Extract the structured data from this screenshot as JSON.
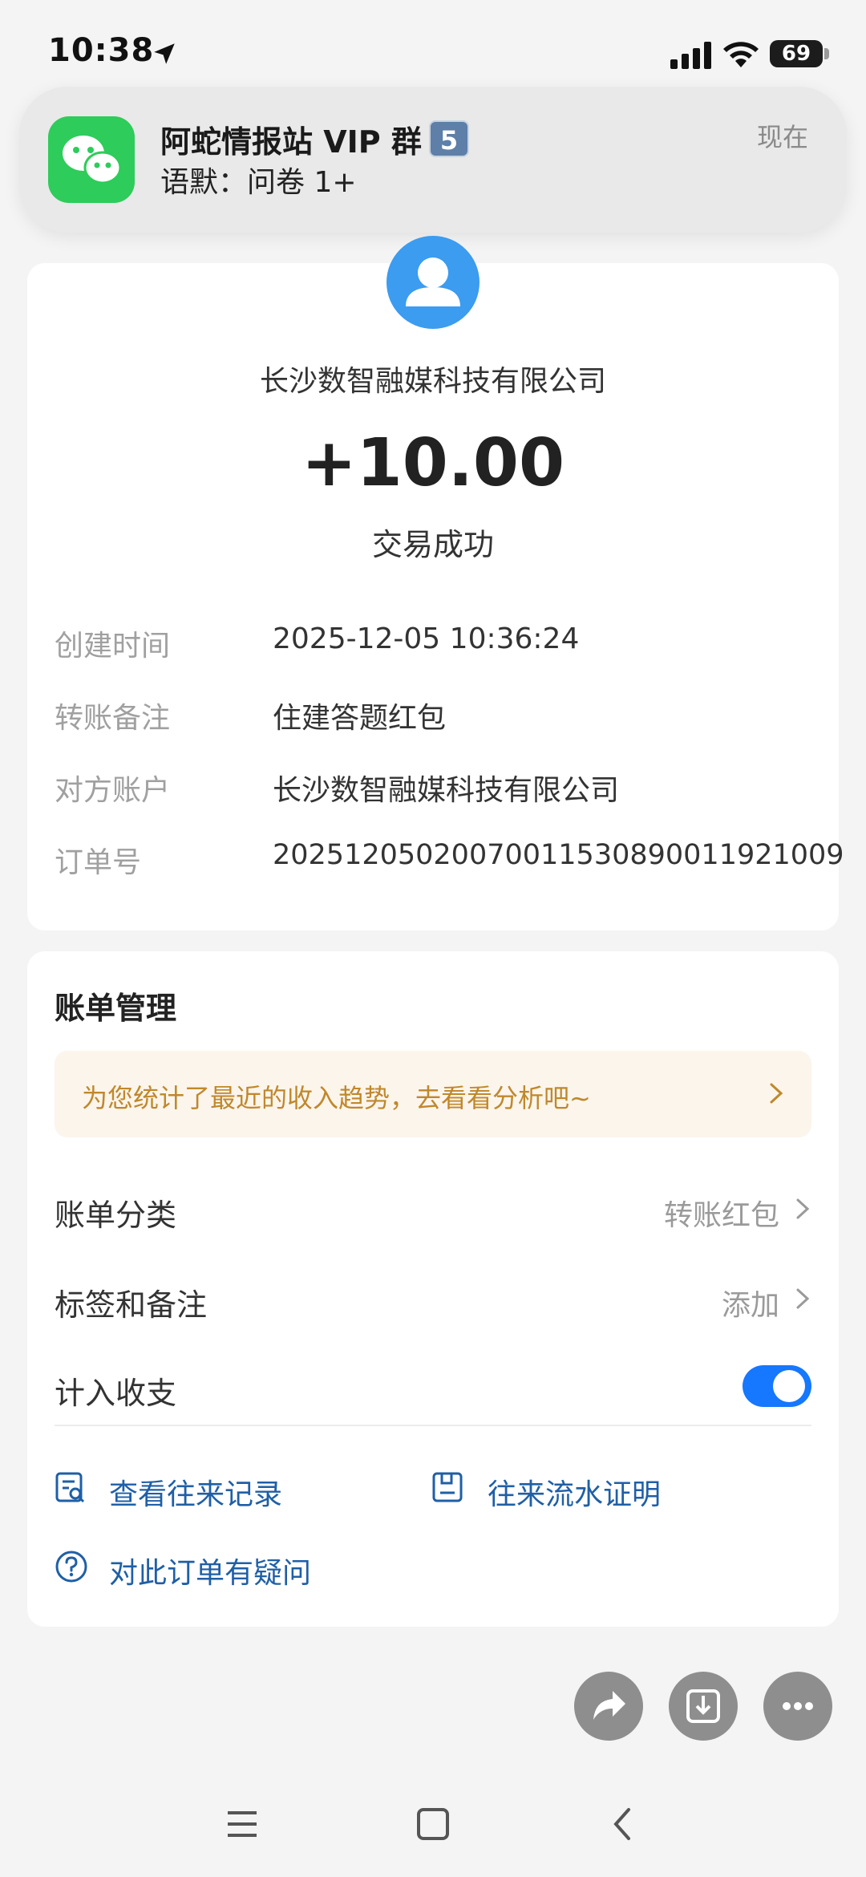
{
  "status_bar": {
    "time": "10:38",
    "battery": "69"
  },
  "notification": {
    "app_icon": "wechat-icon",
    "title": "阿蛇情报站 VIP 群",
    "badge": "5",
    "message": "语默：问卷 1+",
    "time": "现在"
  },
  "transaction": {
    "payer": "长沙数智融媒科技有限公司",
    "amount": "+10.00",
    "status": "交易成功",
    "details": [
      {
        "label": "创建时间",
        "value": "2025-12-05 10:36:24"
      },
      {
        "label": "转账备注",
        "value": "住建答题红包"
      },
      {
        "label": "对方账户",
        "value": "长沙数智融媒科技有限公司"
      },
      {
        "label": "订单号",
        "value": "2025120502007001153089001192 1009"
      }
    ]
  },
  "bill": {
    "title": "账单管理",
    "promo": "为您统计了最近的收入趋势，去看看分析吧~",
    "category_label": "账单分类",
    "category_value": "转账红包",
    "tags_label": "标签和备注",
    "tags_value": "添加",
    "include_label": "计入收支",
    "include_enabled": true,
    "link_records": "查看往来记录",
    "link_proof": "往来流水证明",
    "link_question": "对此订单有疑问"
  },
  "colors": {
    "accent": "#1677ff",
    "link": "#1f5fa6",
    "wechat": "#2ecc5a",
    "avatar": "#3b9cf0",
    "promo_text": "#c0882b"
  }
}
